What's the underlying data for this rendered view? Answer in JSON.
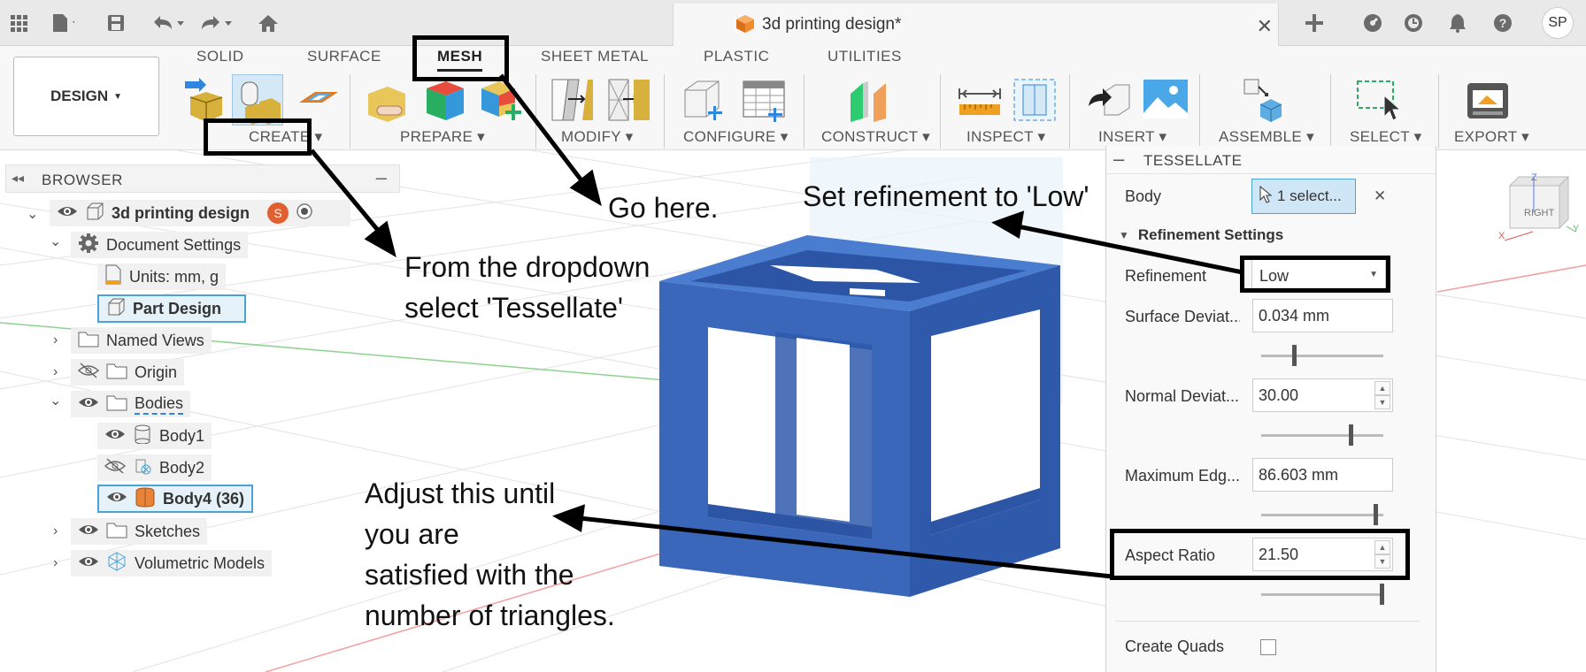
{
  "app": {
    "document_title": "3d printing design*",
    "avatar_initials": "SP"
  },
  "toolbar": {
    "workspace_button": "DESIGN",
    "tabs": [
      "SOLID",
      "SURFACE",
      "MESH",
      "SHEET METAL",
      "PLASTIC",
      "UTILITIES"
    ],
    "groups": [
      "CREATE",
      "PREPARE",
      "MODIFY",
      "CONFIGURE",
      "CONSTRUCT",
      "INSPECT",
      "INSERT",
      "ASSEMBLE",
      "SELECT",
      "EXPORT"
    ]
  },
  "browser": {
    "title": "BROWSER",
    "items": [
      {
        "label": "3d printing design"
      },
      {
        "label": "Document Settings"
      },
      {
        "label": "Units: mm, g"
      },
      {
        "label": "Part Design"
      },
      {
        "label": "Named Views"
      },
      {
        "label": "Origin"
      },
      {
        "label": "Bodies"
      },
      {
        "label": "Body1"
      },
      {
        "label": "Body2"
      },
      {
        "label": "Body4 (36)"
      },
      {
        "label": "Sketches"
      },
      {
        "label": "Volumetric Models"
      }
    ]
  },
  "tessellate": {
    "title": "TESSELLATE",
    "body_label": "Body",
    "body_button": "1 select...",
    "section": "Refinement Settings",
    "refinement_label": "Refinement",
    "refinement_value": "Low",
    "surface_label": "Surface Deviat...",
    "surface_value": "0.034 mm",
    "surface_slider": 0.25,
    "normal_label": "Normal Deviat...",
    "normal_value": "30.00",
    "normal_slider": 0.72,
    "maxedge_label": "Maximum Edg...",
    "maxedge_value": "86.603 mm",
    "maxedge_slider": 0.92,
    "aspect_label": "Aspect Ratio",
    "aspect_value": "21.50",
    "aspect_slider": 0.97,
    "quads_label": "Create Quads"
  },
  "viewcube": {
    "face": "RIGHT",
    "axis_z": "Z",
    "axis_x": "X",
    "axis_y": "Y"
  },
  "annotations": {
    "go_here": "Go here.",
    "dropdown_1": "From the dropdown",
    "dropdown_2": "select 'Tessellate'",
    "refinement": "Set refinement to 'Low'",
    "adjust_1": "Adjust this until",
    "adjust_2": "you are",
    "adjust_3": "satisfied with the",
    "adjust_4": "number of triangles."
  },
  "colors": {
    "accent": "#4aa3d8",
    "model": "#3f6fc0",
    "brand_orange": "#f28b2c"
  }
}
